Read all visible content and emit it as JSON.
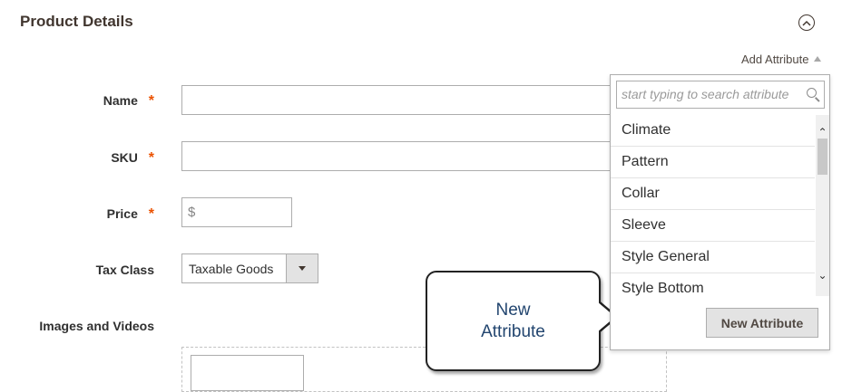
{
  "section": {
    "title": "Product Details"
  },
  "add_attribute": {
    "label": "Add Attribute"
  },
  "form": {
    "name_label": "Name",
    "sku_label": "SKU",
    "price_label": "Price",
    "price_prefix": "$",
    "tax_class_label": "Tax Class",
    "tax_class_value": "Taxable Goods",
    "images_label": "Images and Videos",
    "required_mark": "*"
  },
  "dropdown": {
    "search_placeholder": "start typing to search attribute",
    "items": [
      "Climate",
      "Pattern",
      "Collar",
      "Sleeve",
      "Style General",
      "Style Bottom"
    ],
    "new_attribute_button": "New Attribute"
  },
  "callout": {
    "line1": "New",
    "line2": "Attribute"
  },
  "colors": {
    "required": "#eb5202",
    "callout_text": "#22456f",
    "button_bg": "#e3e3e3"
  }
}
